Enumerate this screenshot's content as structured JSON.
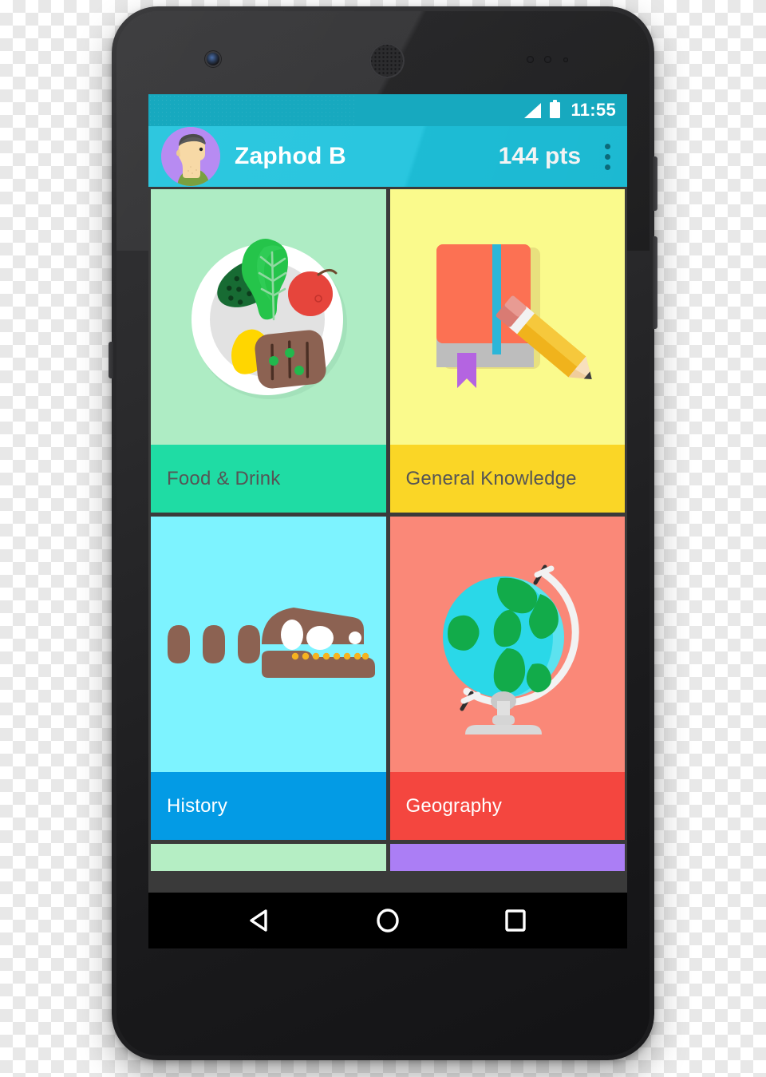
{
  "device": {
    "name": "android-phone",
    "hardware": [
      "front-camera",
      "earpiece-speaker",
      "proximity-sensor",
      "power-button",
      "volume-button"
    ]
  },
  "status_bar": {
    "clock": "11:55",
    "signal_icon": "signal-icon",
    "battery_icon": "battery-icon",
    "bg_color": "#17a9bf"
  },
  "app_bar": {
    "avatar_label": "avatar",
    "user_name": "Zaphod B",
    "points": "144 pts",
    "overflow_label": "overflow-menu",
    "bg_color": "#1ec3dd"
  },
  "grid": {
    "rows": [
      [
        {
          "title": "Food & Drink",
          "icon": "plate-of-food-icon",
          "bg_color": "#aeecc4",
          "footer_color": "#1fdca4",
          "text_color": "#555555"
        },
        {
          "title": "General Knowledge",
          "icon": "book-and-pencil-icon",
          "bg_color": "#fafa8c",
          "footer_color": "#fad626",
          "text_color": "#555555"
        }
      ],
      [
        {
          "title": "History",
          "icon": "dinosaur-skull-icon",
          "bg_color": "#7df3ff",
          "footer_color": "#039be5",
          "text_color": "#ffffff"
        },
        {
          "title": "Geography",
          "icon": "globe-icon",
          "bg_color": "#fa8878",
          "footer_color": "#f4463f",
          "text_color": "#ffffff"
        }
      ]
    ],
    "next_row_peek": [
      {
        "bg_color": "#b5eec4"
      },
      {
        "bg_color": "#ab7ef5"
      }
    ],
    "gutter_color": "#3a3a3a"
  },
  "nav_bar": {
    "back_label": "back-button",
    "home_label": "home-button",
    "recents_label": "recents-button",
    "bg_color": "#000000"
  }
}
